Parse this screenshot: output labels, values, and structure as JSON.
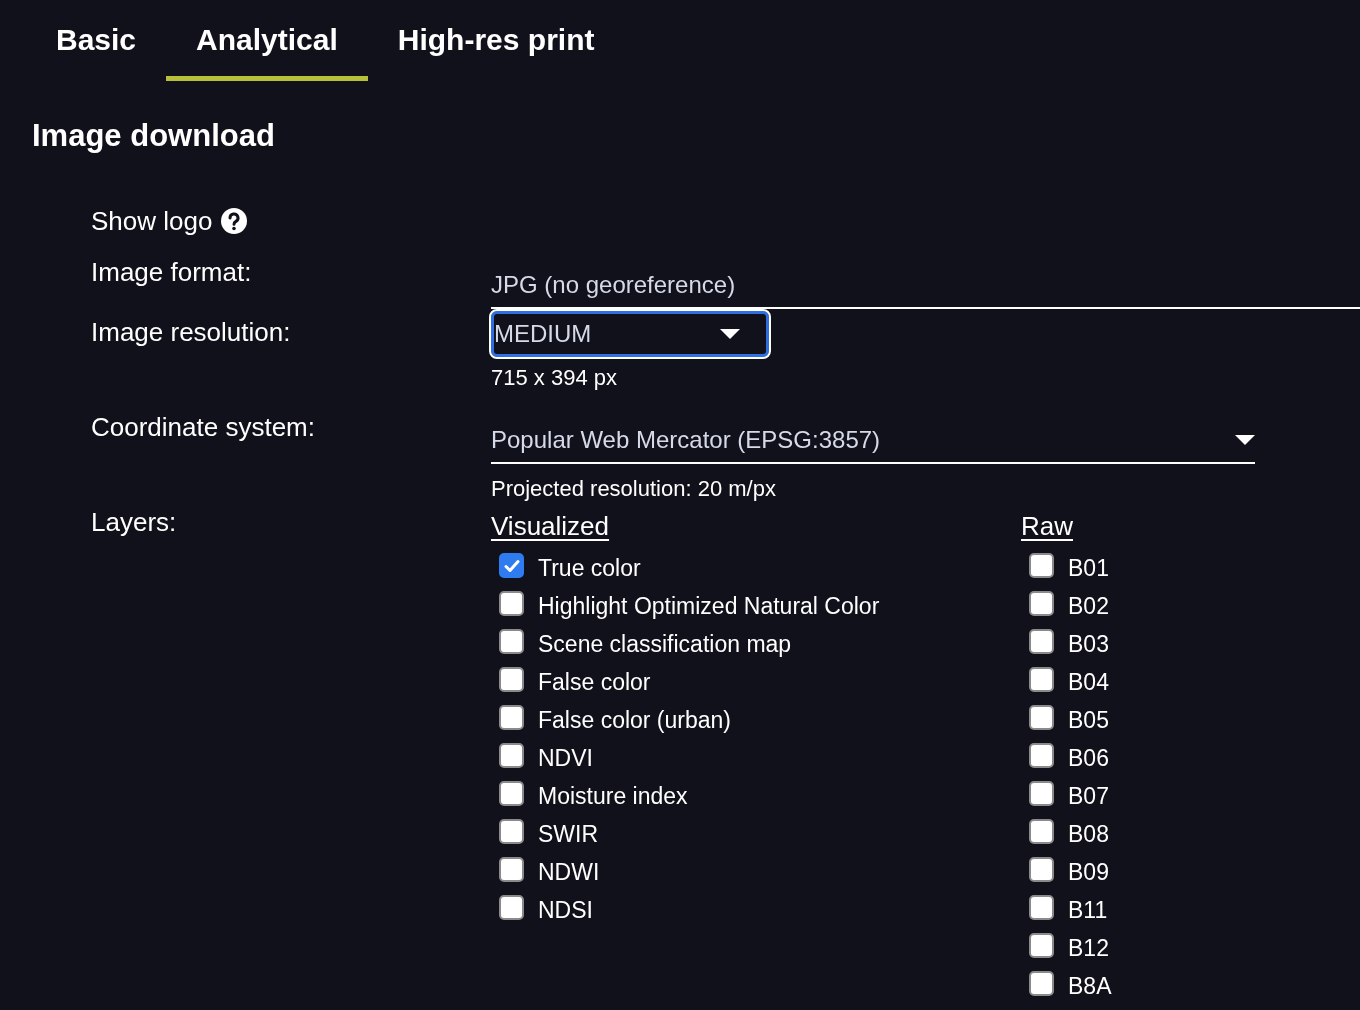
{
  "tabs": [
    {
      "label": "Basic",
      "selected": false
    },
    {
      "label": "Analytical",
      "selected": true
    },
    {
      "label": "High-res print",
      "selected": false
    }
  ],
  "heading": "Image download",
  "show_logo": {
    "label": "Show logo"
  },
  "image_format": {
    "label": "Image format:",
    "value": "JPG (no georeference)"
  },
  "image_resolution": {
    "label": "Image resolution:",
    "value": "MEDIUM",
    "focused": true,
    "note": "715 x 394 px"
  },
  "coordinate_system": {
    "label": "Coordinate system:",
    "value": "Popular Web Mercator (EPSG:3857)",
    "note": "Projected resolution: 20 m/px"
  },
  "layers": {
    "label": "Layers:",
    "groups": [
      {
        "title": "Visualized",
        "items": [
          {
            "label": "True color",
            "checked": true
          },
          {
            "label": "Highlight Optimized Natural Color",
            "checked": false
          },
          {
            "label": "Scene classification map",
            "checked": false
          },
          {
            "label": "False color",
            "checked": false
          },
          {
            "label": "False color (urban)",
            "checked": false
          },
          {
            "label": "NDVI",
            "checked": false
          },
          {
            "label": "Moisture index",
            "checked": false
          },
          {
            "label": "SWIR",
            "checked": false
          },
          {
            "label": "NDWI",
            "checked": false
          },
          {
            "label": "NDSI",
            "checked": false
          }
        ]
      },
      {
        "title": "Raw",
        "items": [
          {
            "label": "B01",
            "checked": false
          },
          {
            "label": "B02",
            "checked": false
          },
          {
            "label": "B03",
            "checked": false
          },
          {
            "label": "B04",
            "checked": false
          },
          {
            "label": "B05",
            "checked": false
          },
          {
            "label": "B06",
            "checked": false
          },
          {
            "label": "B07",
            "checked": false
          },
          {
            "label": "B08",
            "checked": false
          },
          {
            "label": "B09",
            "checked": false
          },
          {
            "label": "B11",
            "checked": false
          },
          {
            "label": "B12",
            "checked": false
          },
          {
            "label": "B8A",
            "checked": false
          }
        ]
      }
    ]
  }
}
